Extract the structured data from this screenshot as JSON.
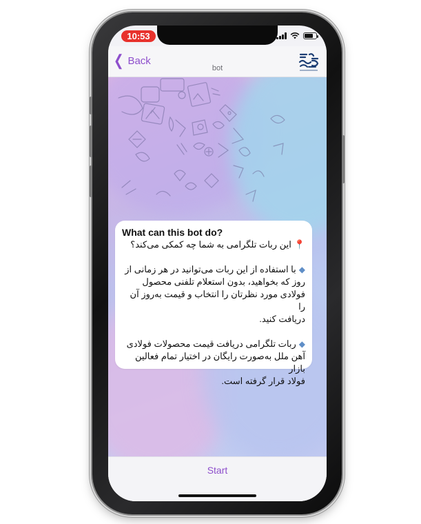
{
  "status_bar": {
    "time": "10:53"
  },
  "nav": {
    "back_label": "Back",
    "title": "bot"
  },
  "bot_info": {
    "heading": "What can this bot do?",
    "intro": "این ربات تلگرامی به شما چه کمکی می‌کند؟",
    "para1_lines": [
      "با استفاده از این ربات می‌توانید در هر زمانی از",
      "روز که بخواهید، بدون استعلام تلفنی محصول",
      "فولادی مورد نظرتان را انتخاب و قیمت به‌روز آن را",
      "دریافت کنید."
    ],
    "para2_lines": [
      "ربات تلگرامی دریافت قیمت محصولات فولادی",
      "آهن ملل به‌صورت رایگان در اختیار تمام فعالین بازار",
      "فولاد قرار گرفته است."
    ]
  },
  "bottom": {
    "start_label": "Start"
  },
  "icons": {
    "pin": "round-pushpin-icon",
    "diamond": "blue-diamond-icon",
    "logo": "ahan-melal-logo"
  },
  "colors": {
    "accent": "#8e4fcc",
    "time_pill": "#e8322d"
  }
}
